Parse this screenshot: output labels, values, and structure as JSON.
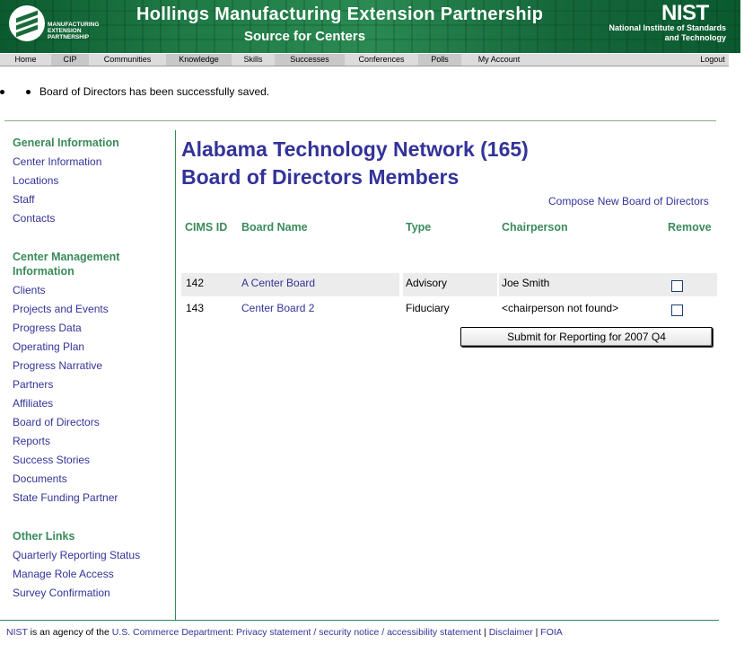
{
  "banner": {
    "mep_logo_text": "MANUFACTURING EXTENSION PARTNERSHIP",
    "title": "Hollings Manufacturing Extension Partnership",
    "subtitle": "Source for Centers",
    "nist_logo": "NIST",
    "nist_name": "National Institute of Standards and Technology"
  },
  "nav": {
    "items": [
      "Home",
      "CIP",
      "Communities",
      "Knowledge",
      "Skills",
      "Successes",
      "Conferences",
      "Polls",
      "My Account"
    ],
    "logout": "Logout"
  },
  "message": "Board of Directors has been successfully saved.",
  "sidebar": {
    "general_heading": "General Information",
    "general_links": [
      "Center Information",
      "Locations",
      "Staff",
      "Contacts"
    ],
    "management_heading": "Center Management Information",
    "management_links": [
      "Clients",
      "Projects and Events",
      "Progress Data",
      "Operating Plan",
      "Progress Narrative",
      "Partners",
      "Affiliates",
      "Board of Directors",
      "Reports",
      "Success Stories",
      "Documents",
      "State Funding Partner"
    ],
    "other_heading": "Other Links",
    "other_links": [
      "Quarterly Reporting Status",
      "Manage Role Access",
      "Survey Confirmation"
    ]
  },
  "main": {
    "title_line1": "Alabama Technology Network (165)",
    "title_line2": "Board of Directors Members",
    "compose_link": "Compose New Board of Directors",
    "columns": [
      "CIMS ID",
      "Board Name",
      "Type",
      "Chairperson",
      "Remove"
    ],
    "rows": [
      {
        "cims_id": "142",
        "board_name": "A Center Board",
        "type": "Advisory",
        "chairperson": "Joe Smith"
      },
      {
        "cims_id": "143",
        "board_name": "Center Board 2",
        "type": "Fiduciary",
        "chairperson": "<chairperson not found>"
      }
    ],
    "submit_label": "Submit for Reporting for 2007 Q4"
  },
  "footer": {
    "nist": "NIST",
    "text1": " is an agency of the ",
    "commerce": "U.S. Commerce Department",
    "text2": ": ",
    "privacy": "Privacy statement / security notice / accessibility statement",
    "sep1": " | ",
    "disclaimer": "Disclaimer",
    "sep2": " | ",
    "foia": "FOIA"
  },
  "colors": {
    "banner_green": "#1f7a45",
    "heading_green": "#3a8a5a",
    "link_blue": "#333399"
  }
}
